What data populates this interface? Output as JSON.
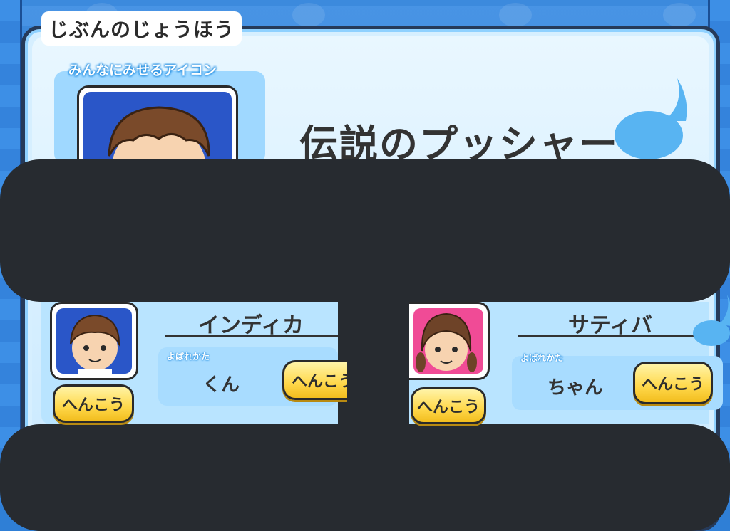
{
  "section_title": "じぶんのじょうほう",
  "icon_caption": "みんなにみせるアイコン",
  "player_title": "伝説のプッシャー",
  "characters": [
    {
      "name": "インディカ",
      "call_caption": "よばれかた",
      "call_value": "くん",
      "change_icon_label": "へんこう",
      "change_call_label": "へんこう"
    },
    {
      "name": "サティバ",
      "call_caption": "よばれかた",
      "call_value": "ちゃん",
      "change_icon_label": "へんこう",
      "change_call_label": "へんこう"
    }
  ],
  "colors": {
    "panel_border": "#263a59",
    "panel_fill": "#d6efff",
    "button_yellow": "#ffd84a",
    "avatar_blue": "#2a56c8",
    "avatar_pink": "#f04b96",
    "redaction": "#272b30"
  }
}
